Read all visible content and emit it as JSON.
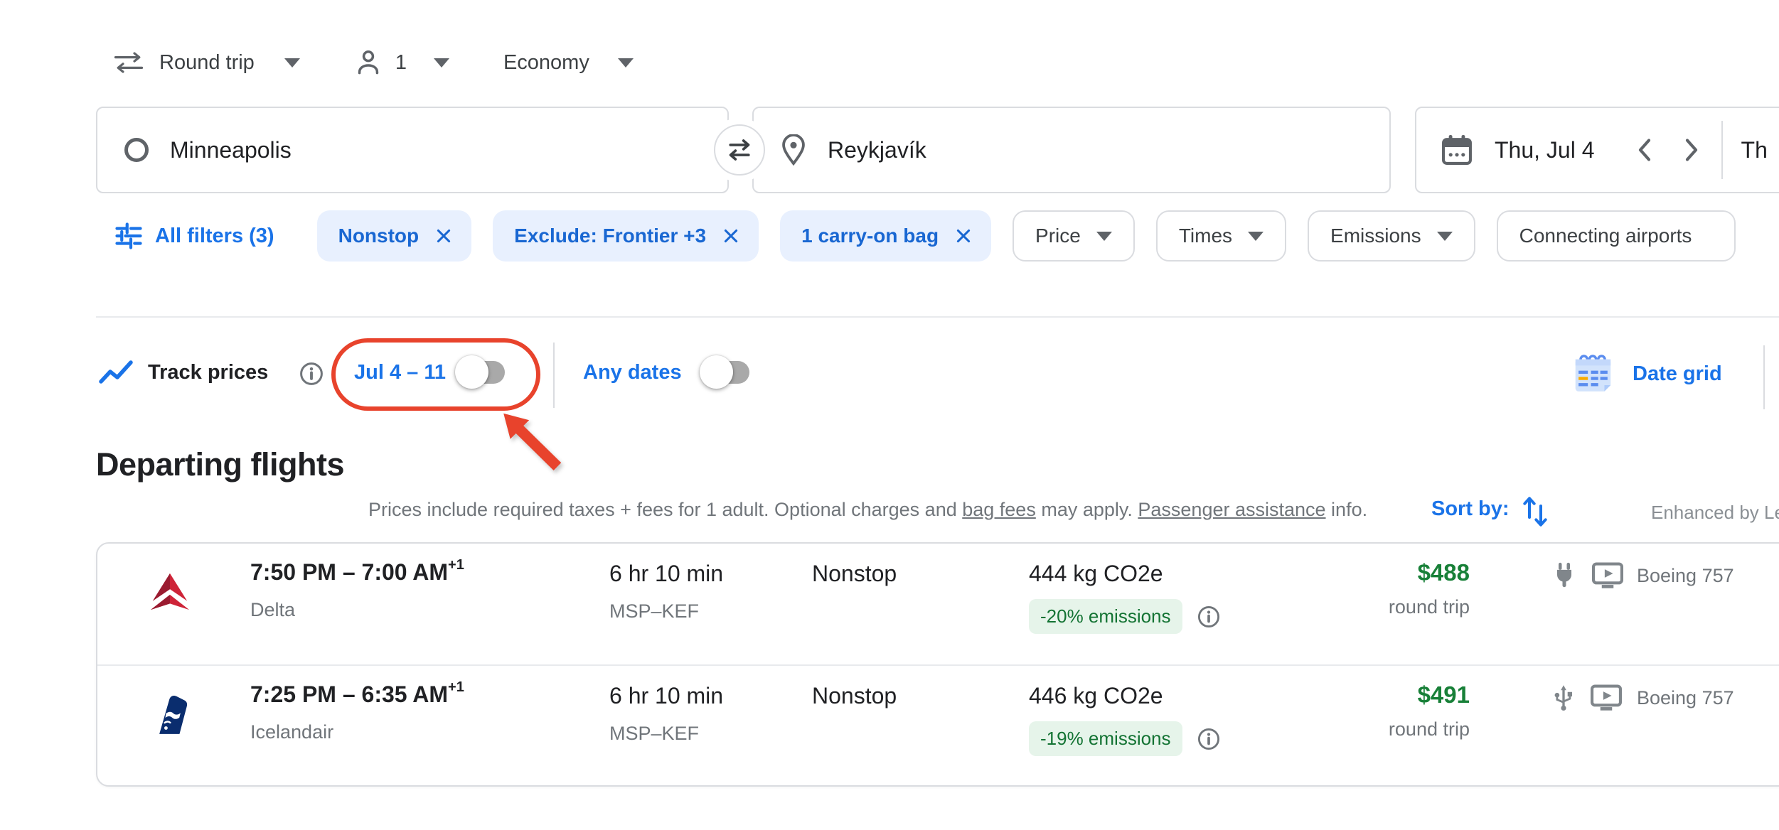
{
  "topbar": {
    "trip_type": "Round trip",
    "passengers": "1",
    "cabin_class": "Economy"
  },
  "search_form": {
    "origin": "Minneapolis",
    "destination": "Reykjavík",
    "departure_date": "Thu, Jul 4",
    "return_date_partial": "Th"
  },
  "filter_bar": {
    "all_filters": {
      "label": "All filters (3)"
    },
    "active_chips": [
      {
        "label": "Nonstop"
      },
      {
        "label": "Exclude: Frontier +3"
      },
      {
        "label": "1 carry-on bag"
      }
    ],
    "dropdown_chips": [
      {
        "label": "Price"
      },
      {
        "label": "Times"
      },
      {
        "label": "Emissions"
      }
    ],
    "plain_chips": [
      {
        "label": "Connecting airports"
      }
    ]
  },
  "track_prices_bar": {
    "track_prices_label": "Track prices",
    "date_range": {
      "label": "Jul 4 – 11",
      "toggle_state": "off"
    },
    "any_dates": {
      "label": "Any dates",
      "toggle_state": "off"
    },
    "date_grid_label": "Date grid",
    "annotation": {
      "type": "red circle and arrow highlighting date-range toggle",
      "color": "#e8432c"
    }
  },
  "departing_flights": {
    "title": "Departing flights",
    "disclaimer": {
      "part1": "Prices include required taxes + fees for 1 adult. Optional charges and ",
      "link1": "bag fees",
      "part2": " may apply. ",
      "link2": "Passenger assistance",
      "part3": " info."
    },
    "sort_by_label": "Sort by:",
    "enhanced_label": "Enhanced by Le"
  },
  "flights": [
    {
      "airline": "Delta",
      "time_range": "7:50 PM – 7:00 AM",
      "arrival_day_offset": "+1",
      "duration": "6 hr 10 min",
      "route": "MSP–KEF",
      "stops": "Nonstop",
      "co2": "444 kg CO2e",
      "emissions_badge": "-20% emissions",
      "price": "$488",
      "price_qualifier": "round trip",
      "aircraft": "Boeing 757",
      "amenities": [
        "power-outlet-icon",
        "seatback-video-icon"
      ]
    },
    {
      "airline": "Icelandair",
      "time_range": "7:25 PM – 6:35 AM",
      "arrival_day_offset": "+1",
      "duration": "6 hr 10 min",
      "route": "MSP–KEF",
      "stops": "Nonstop",
      "co2": "446 kg CO2e",
      "emissions_badge": "-19% emissions",
      "price": "$491",
      "price_qualifier": "round trip",
      "aircraft": "Boeing 757",
      "amenities": [
        "usb-icon",
        "seatback-video-icon"
      ]
    }
  ],
  "colors": {
    "link_blue": "#1a73e8",
    "chip_bg_blue": "#e8f0fe",
    "chip_text_blue": "#1967d2",
    "price_green": "#188038",
    "emissions_badge_bg": "#e6f4ea",
    "emissions_badge_text": "#137333",
    "annotation_red": "#e8432c",
    "text_primary": "#202124",
    "text_secondary": "#70757a",
    "border_gray": "#dadce0"
  }
}
